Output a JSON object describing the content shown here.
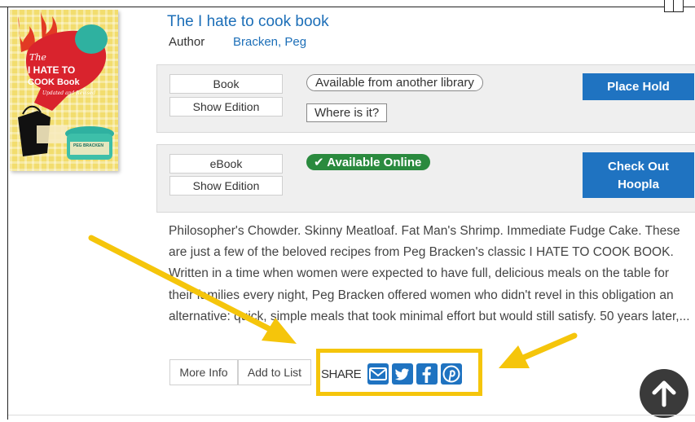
{
  "book": {
    "title": "The I hate to cook book",
    "author_label": "Author",
    "author_name": "Bracken, Peg",
    "cover_text": {
      "line1": "The",
      "line2": "I HATE TO",
      "line3": "COOK Book",
      "line4": "Updated and Revised",
      "author": "PEG BRACKEN"
    }
  },
  "formats": [
    {
      "format_label": "Book",
      "edition_label": "Show Edition",
      "status": "Available from another library",
      "secondary": "Where is it?",
      "action": "Place Hold"
    },
    {
      "format_label": "eBook",
      "edition_label": "Show Edition",
      "status": "Available Online",
      "action_line1": "Check Out",
      "action_line2": "Hoopla"
    }
  ],
  "description": "Philosopher's Chowder. Skinny Meatloaf. Fat Man's Shrimp. Immediate Fudge Cake. These are just a few of the beloved recipes from Peg Bracken's classic I HATE TO COOK BOOK. Written in a time when women were expected to have full, delicious meals on the table for their families every night, Peg Bracken offered women who didn't revel in this obligation an alternative: quick, simple meals that took minimal effort but would still satisfy. 50 years later,...",
  "actions": {
    "more_info": "More Info",
    "add_to_list": "Add to List",
    "share_label": "SHARE"
  },
  "share_icons": [
    "email-icon",
    "twitter-icon",
    "facebook-icon",
    "pinterest-icon"
  ],
  "colors": {
    "link": "#1d6fb8",
    "primary_button": "#1f73c1",
    "available_online": "#2a8a3e",
    "highlight": "#f5c50b"
  }
}
